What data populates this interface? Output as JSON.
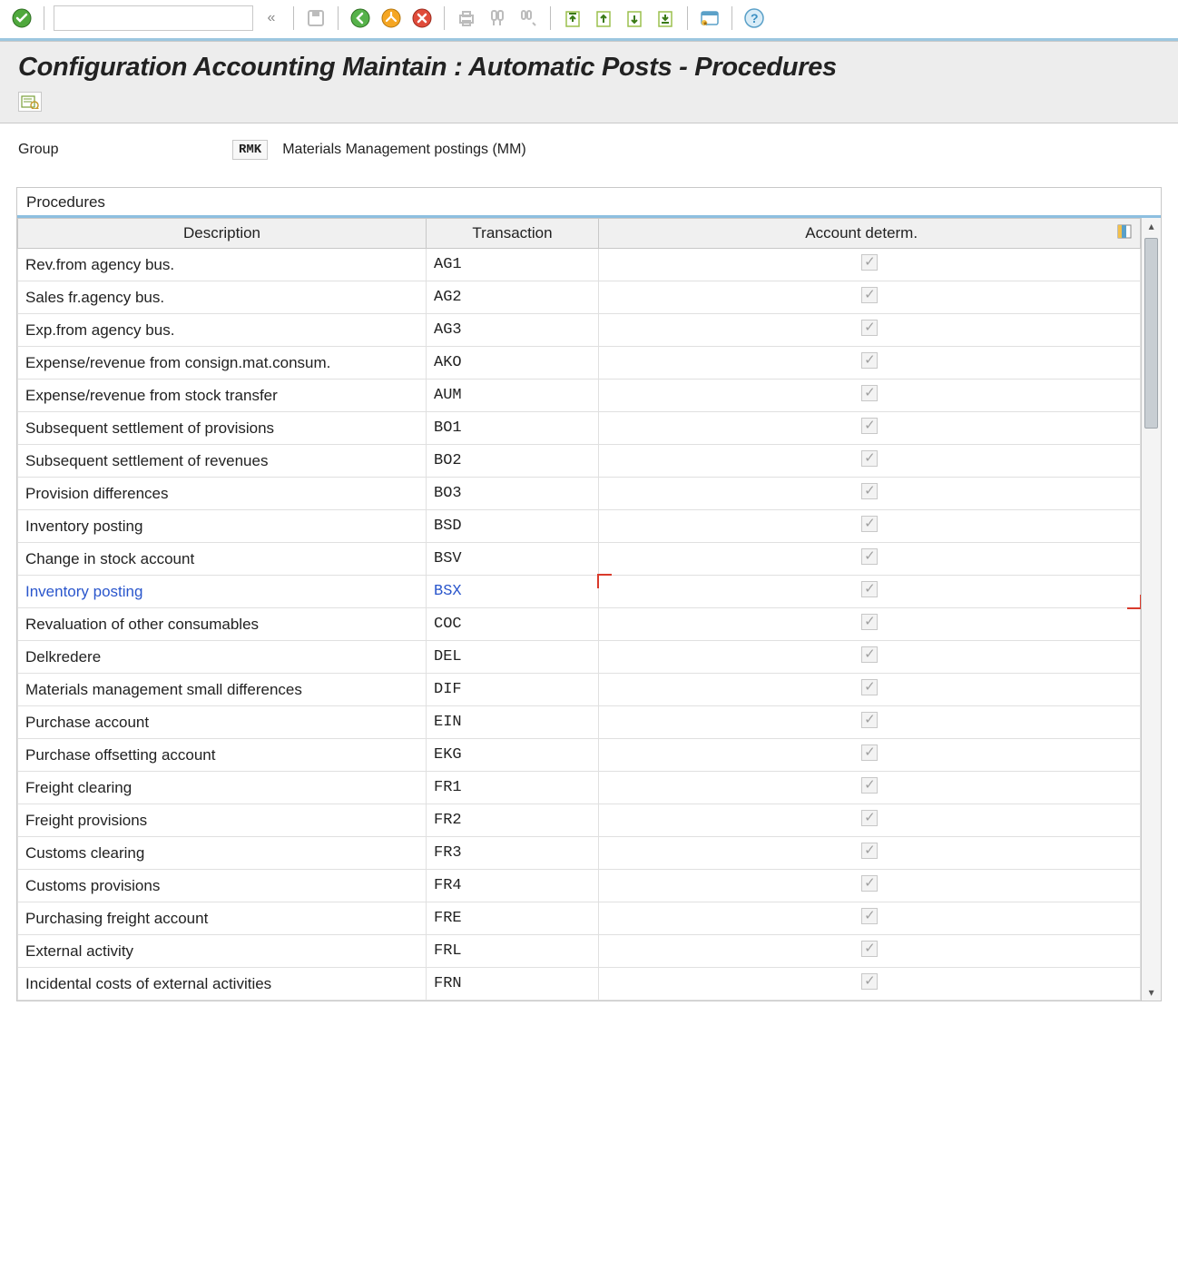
{
  "toolbar": {
    "icons": [
      "ok-icon",
      "sep",
      "cmd-field",
      "chevrons-left-icon",
      "sep",
      "save-icon",
      "sep",
      "back-icon",
      "exit-icon",
      "cancel-icon",
      "sep",
      "print-icon",
      "find-icon",
      "find-next-icon",
      "sep",
      "first-page-icon",
      "prev-page-icon",
      "next-page-icon",
      "last-page-icon",
      "sep",
      "new-session-icon",
      "sep",
      "help-icon"
    ]
  },
  "page": {
    "title": "Configuration Accounting Maintain : Automatic Posts - Procedures"
  },
  "header": {
    "group_label": "Group",
    "group_code": "RMK",
    "group_text": "Materials Management postings (MM)"
  },
  "panel": {
    "title": "Procedures",
    "columns": {
      "description": "Description",
      "transaction": "Transaction",
      "account_determ": "Account determ."
    }
  },
  "rows": [
    {
      "desc": "Rev.from agency bus.",
      "txn": "AG1",
      "acc": true,
      "sel": false
    },
    {
      "desc": "Sales fr.agency bus.",
      "txn": "AG2",
      "acc": true,
      "sel": false
    },
    {
      "desc": "Exp.from agency bus.",
      "txn": "AG3",
      "acc": true,
      "sel": false
    },
    {
      "desc": "Expense/revenue from consign.mat.consum.",
      "txn": "AKO",
      "acc": true,
      "sel": false
    },
    {
      "desc": "Expense/revenue from stock transfer",
      "txn": "AUM",
      "acc": true,
      "sel": false
    },
    {
      "desc": "Subsequent settlement of provisions",
      "txn": "BO1",
      "acc": true,
      "sel": false
    },
    {
      "desc": "Subsequent settlement of revenues",
      "txn": "BO2",
      "acc": true,
      "sel": false
    },
    {
      "desc": "Provision differences",
      "txn": "BO3",
      "acc": true,
      "sel": false
    },
    {
      "desc": "Inventory posting",
      "txn": "BSD",
      "acc": true,
      "sel": false
    },
    {
      "desc": "Change in stock account",
      "txn": "BSV",
      "acc": true,
      "sel": false
    },
    {
      "desc": "Inventory posting",
      "txn": "BSX",
      "acc": true,
      "sel": true
    },
    {
      "desc": "Revaluation of other consumables",
      "txn": "COC",
      "acc": true,
      "sel": false
    },
    {
      "desc": "Delkredere",
      "txn": "DEL",
      "acc": true,
      "sel": false
    },
    {
      "desc": "Materials management small differences",
      "txn": "DIF",
      "acc": true,
      "sel": false
    },
    {
      "desc": "Purchase account",
      "txn": "EIN",
      "acc": true,
      "sel": false
    },
    {
      "desc": "Purchase offsetting account",
      "txn": "EKG",
      "acc": true,
      "sel": false
    },
    {
      "desc": "Freight clearing",
      "txn": "FR1",
      "acc": true,
      "sel": false
    },
    {
      "desc": "Freight provisions",
      "txn": "FR2",
      "acc": true,
      "sel": false
    },
    {
      "desc": "Customs clearing",
      "txn": "FR3",
      "acc": true,
      "sel": false
    },
    {
      "desc": "Customs provisions",
      "txn": "FR4",
      "acc": true,
      "sel": false
    },
    {
      "desc": "Purchasing freight account",
      "txn": "FRE",
      "acc": true,
      "sel": false
    },
    {
      "desc": "External activity",
      "txn": "FRL",
      "acc": true,
      "sel": false
    },
    {
      "desc": "Incidental costs of external activities",
      "txn": "FRN",
      "acc": true,
      "sel": false
    }
  ]
}
